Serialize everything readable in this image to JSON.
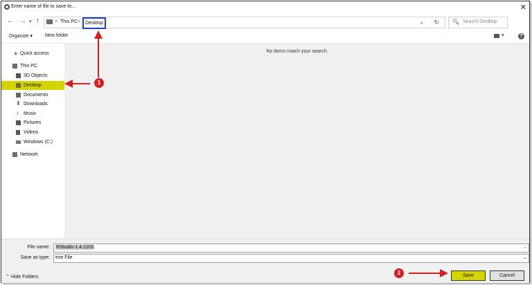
{
  "window": {
    "title": "Enter name of file to save to..."
  },
  "nav": {
    "back": "←",
    "forward": "→",
    "recent": "▾",
    "up": "↑"
  },
  "address": {
    "crumbs": [
      "This PC",
      "Desktop"
    ],
    "separator": ">",
    "dropdown": "⌄",
    "refresh": "↻"
  },
  "search": {
    "placeholder": "Search Desktop",
    "icon": "🔍"
  },
  "toolbar": {
    "organize": "Organize ▾",
    "new_folder": "New folder",
    "help": "?"
  },
  "sidebar": {
    "items": [
      {
        "label": "Quick access",
        "icon": "star-icon"
      },
      {
        "label": "This PC",
        "icon": "computer-icon"
      },
      {
        "label": "3D Objects",
        "icon": "cube-icon"
      },
      {
        "label": "Desktop",
        "icon": "desktop-icon"
      },
      {
        "label": "Documents",
        "icon": "document-icon"
      },
      {
        "label": "Downloads",
        "icon": "download-icon"
      },
      {
        "label": "Music",
        "icon": "music-icon"
      },
      {
        "label": "Pictures",
        "icon": "picture-icon"
      },
      {
        "label": "Videos",
        "icon": "video-icon"
      },
      {
        "label": "Windows (C:)",
        "icon": "drive-icon"
      },
      {
        "label": "Network",
        "icon": "network-icon"
      }
    ],
    "selected": "Desktop"
  },
  "content": {
    "empty_message": "No items match your search."
  },
  "form": {
    "file_name_label": "File name:",
    "file_name_value": "RStudio-1.4.1103",
    "save_type_label": "Save as type:",
    "save_type_value": "exe File"
  },
  "footer": {
    "hide_folders": "Hide Folders",
    "save": "Save",
    "cancel": "Cancel"
  },
  "annotations": {
    "marker1": "1",
    "marker2": "2"
  },
  "colors": {
    "highlight": "#d4d400",
    "arrow": "#d02020",
    "focus_box": "#1a3fcf"
  }
}
